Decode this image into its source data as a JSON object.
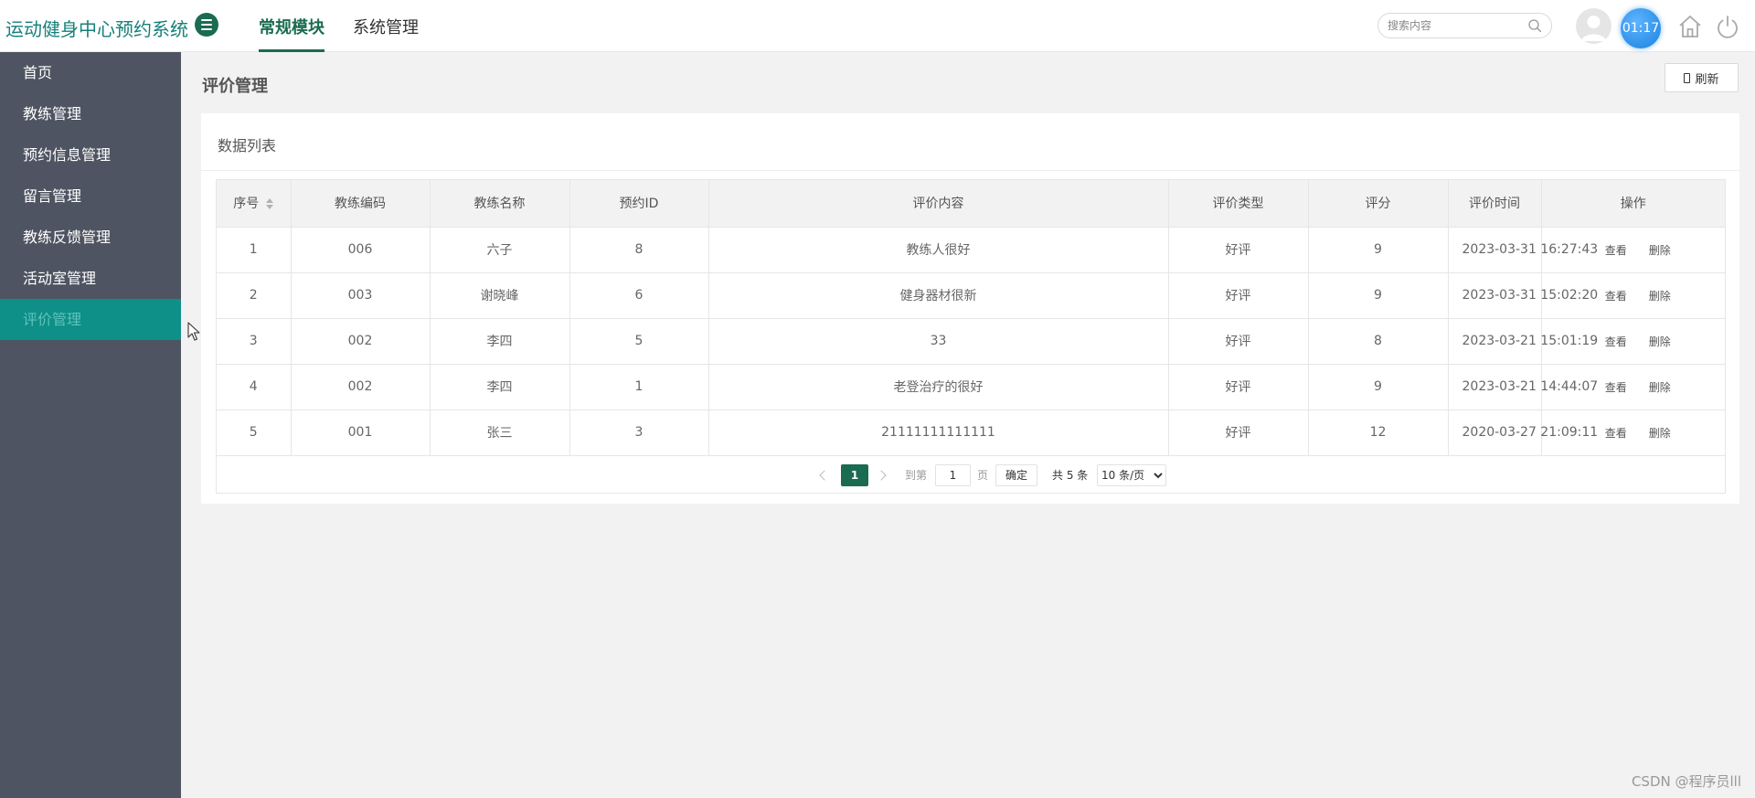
{
  "header": {
    "app_title": "运动健身中心预约系统",
    "tabs": [
      {
        "label": "常规模块",
        "active": true
      },
      {
        "label": "系统管理",
        "active": false
      }
    ],
    "search_placeholder": "搜索内容",
    "clock": "01:17"
  },
  "sidebar": {
    "items": [
      {
        "label": "首页"
      },
      {
        "label": "教练管理"
      },
      {
        "label": "预约信息管理"
      },
      {
        "label": "留言管理"
      },
      {
        "label": "教练反馈管理"
      },
      {
        "label": "活动室管理"
      },
      {
        "label": "评价管理",
        "active": true
      }
    ]
  },
  "main": {
    "page_title": "评价管理",
    "refresh_label": "刷新",
    "card_title": "数据列表"
  },
  "table": {
    "columns": [
      "序号",
      "教练编码",
      "教练名称",
      "预约ID",
      "评价内容",
      "评价类型",
      "评分",
      "评价时间",
      "操作"
    ],
    "view_label": "查看",
    "delete_label": "删除",
    "rows": [
      {
        "index": "1",
        "coach_code": "006",
        "coach_name": "六子",
        "booking_id": "8",
        "content": "教练人很好",
        "type": "好评",
        "score": "9",
        "time": "2023-03-31 16:27:43"
      },
      {
        "index": "2",
        "coach_code": "003",
        "coach_name": "谢晓峰",
        "booking_id": "6",
        "content": "健身器材很新",
        "type": "好评",
        "score": "9",
        "time": "2023-03-31 15:02:20"
      },
      {
        "index": "3",
        "coach_code": "002",
        "coach_name": "李四",
        "booking_id": "5",
        "content": "33",
        "type": "好评",
        "score": "8",
        "time": "2023-03-21 15:01:19"
      },
      {
        "index": "4",
        "coach_code": "002",
        "coach_name": "李四",
        "booking_id": "1",
        "content": "老登治疗的很好",
        "type": "好评",
        "score": "9",
        "time": "2023-03-21 14:44:07"
      },
      {
        "index": "5",
        "coach_code": "001",
        "coach_name": "张三",
        "booking_id": "3",
        "content": "21111111111111",
        "type": "好评",
        "score": "12",
        "time": "2020-03-27 21:09:11"
      }
    ]
  },
  "pagination": {
    "current_page": "1",
    "goto_label": "到第",
    "goto_value": "1",
    "page_suffix": "页",
    "confirm_label": "确定",
    "total_label": "共 5 条",
    "page_size": "10 条/页"
  },
  "watermark": "CSDN @程序员lll",
  "colors": {
    "accent": "#1a6b51",
    "sidebar_bg": "#4e5461",
    "sidebar_active_bg": "#0e8f88",
    "title_teal": "#16807a"
  }
}
